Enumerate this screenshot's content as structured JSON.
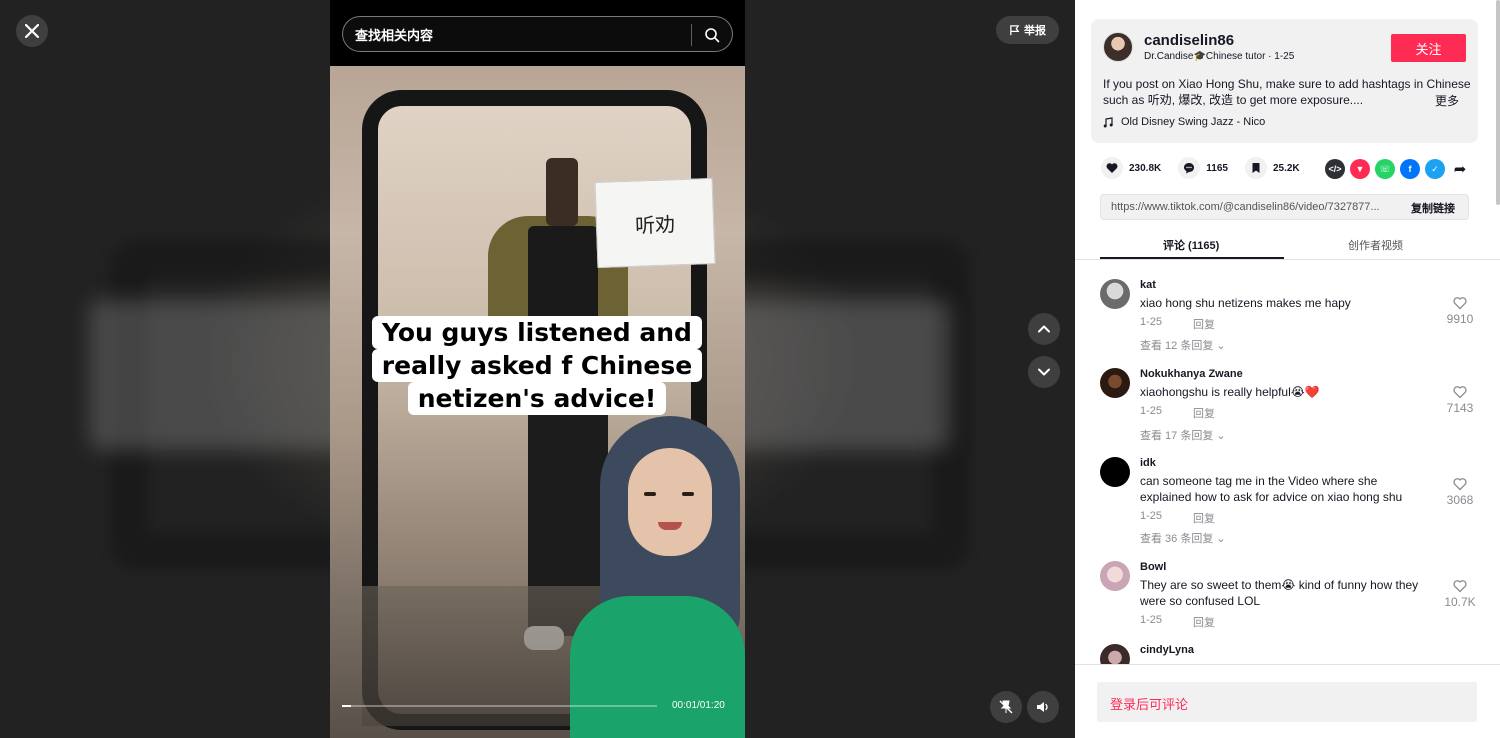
{
  "search": {
    "placeholder": "查找相关内容"
  },
  "report": {
    "label": "举报"
  },
  "video": {
    "caption_lines": [
      "You guys listened and",
      "really asked f    Chinese",
      "netizen's advice!"
    ],
    "sign_text": "听劝",
    "time": "00:01/01:20",
    "progress": 0.03
  },
  "author": {
    "username": "candiselin86",
    "subtitle": "Dr.Candise🎓Chinese tutor · 1-25",
    "follow_label": "关注",
    "description": "If you post on Xiao Hong Shu, make sure to add hashtags in Chinese such as 听劝, 爆改, 改造 to get more exposure....",
    "more_label": "更多",
    "music": "Old Disney Swing Jazz - Nico"
  },
  "stats": {
    "likes": "230.8K",
    "comments": "1165",
    "saves": "25.2K"
  },
  "share": {
    "link": "https://www.tiktok.com/@candiselin86/video/7327877...",
    "copy_label": "复制链接"
  },
  "tabs": {
    "comments": "评论 (1165)",
    "creator_videos": "创作者视频"
  },
  "comments": [
    {
      "user": "kat",
      "text": "xiao hong shu netizens makes me hapy",
      "date": "1-25",
      "reply": "回复",
      "more": "查看 12 条回复",
      "likes": "9910"
    },
    {
      "user": "Nokukhanya Zwane",
      "text": "xiaohongshu is really helpful😭❤️",
      "date": "1-25",
      "reply": "回复",
      "more": "查看 17 条回复",
      "likes": "7143"
    },
    {
      "user": "idk",
      "text": "can someone tag me in the Video where she explained how to ask for advice on xiao hong shu",
      "date": "1-25",
      "reply": "回复",
      "more": "查看 36 条回复",
      "likes": "3068"
    },
    {
      "user": "Bowl",
      "text": "They are so sweet to them😭 kind of funny how they were so confused LOL",
      "date": "1-25",
      "reply": "回复",
      "more": "",
      "likes": "10.7K"
    },
    {
      "user": "cindyLyna",
      "text": "",
      "date": "",
      "reply": "",
      "more": "",
      "likes": ""
    }
  ],
  "bottom": {
    "login_comment": "登录后可评论"
  },
  "colors": {
    "accent": "#fe2c55",
    "panel_bg": "#f1f1f2",
    "text": "#161823",
    "muted": "#8a8b91"
  }
}
